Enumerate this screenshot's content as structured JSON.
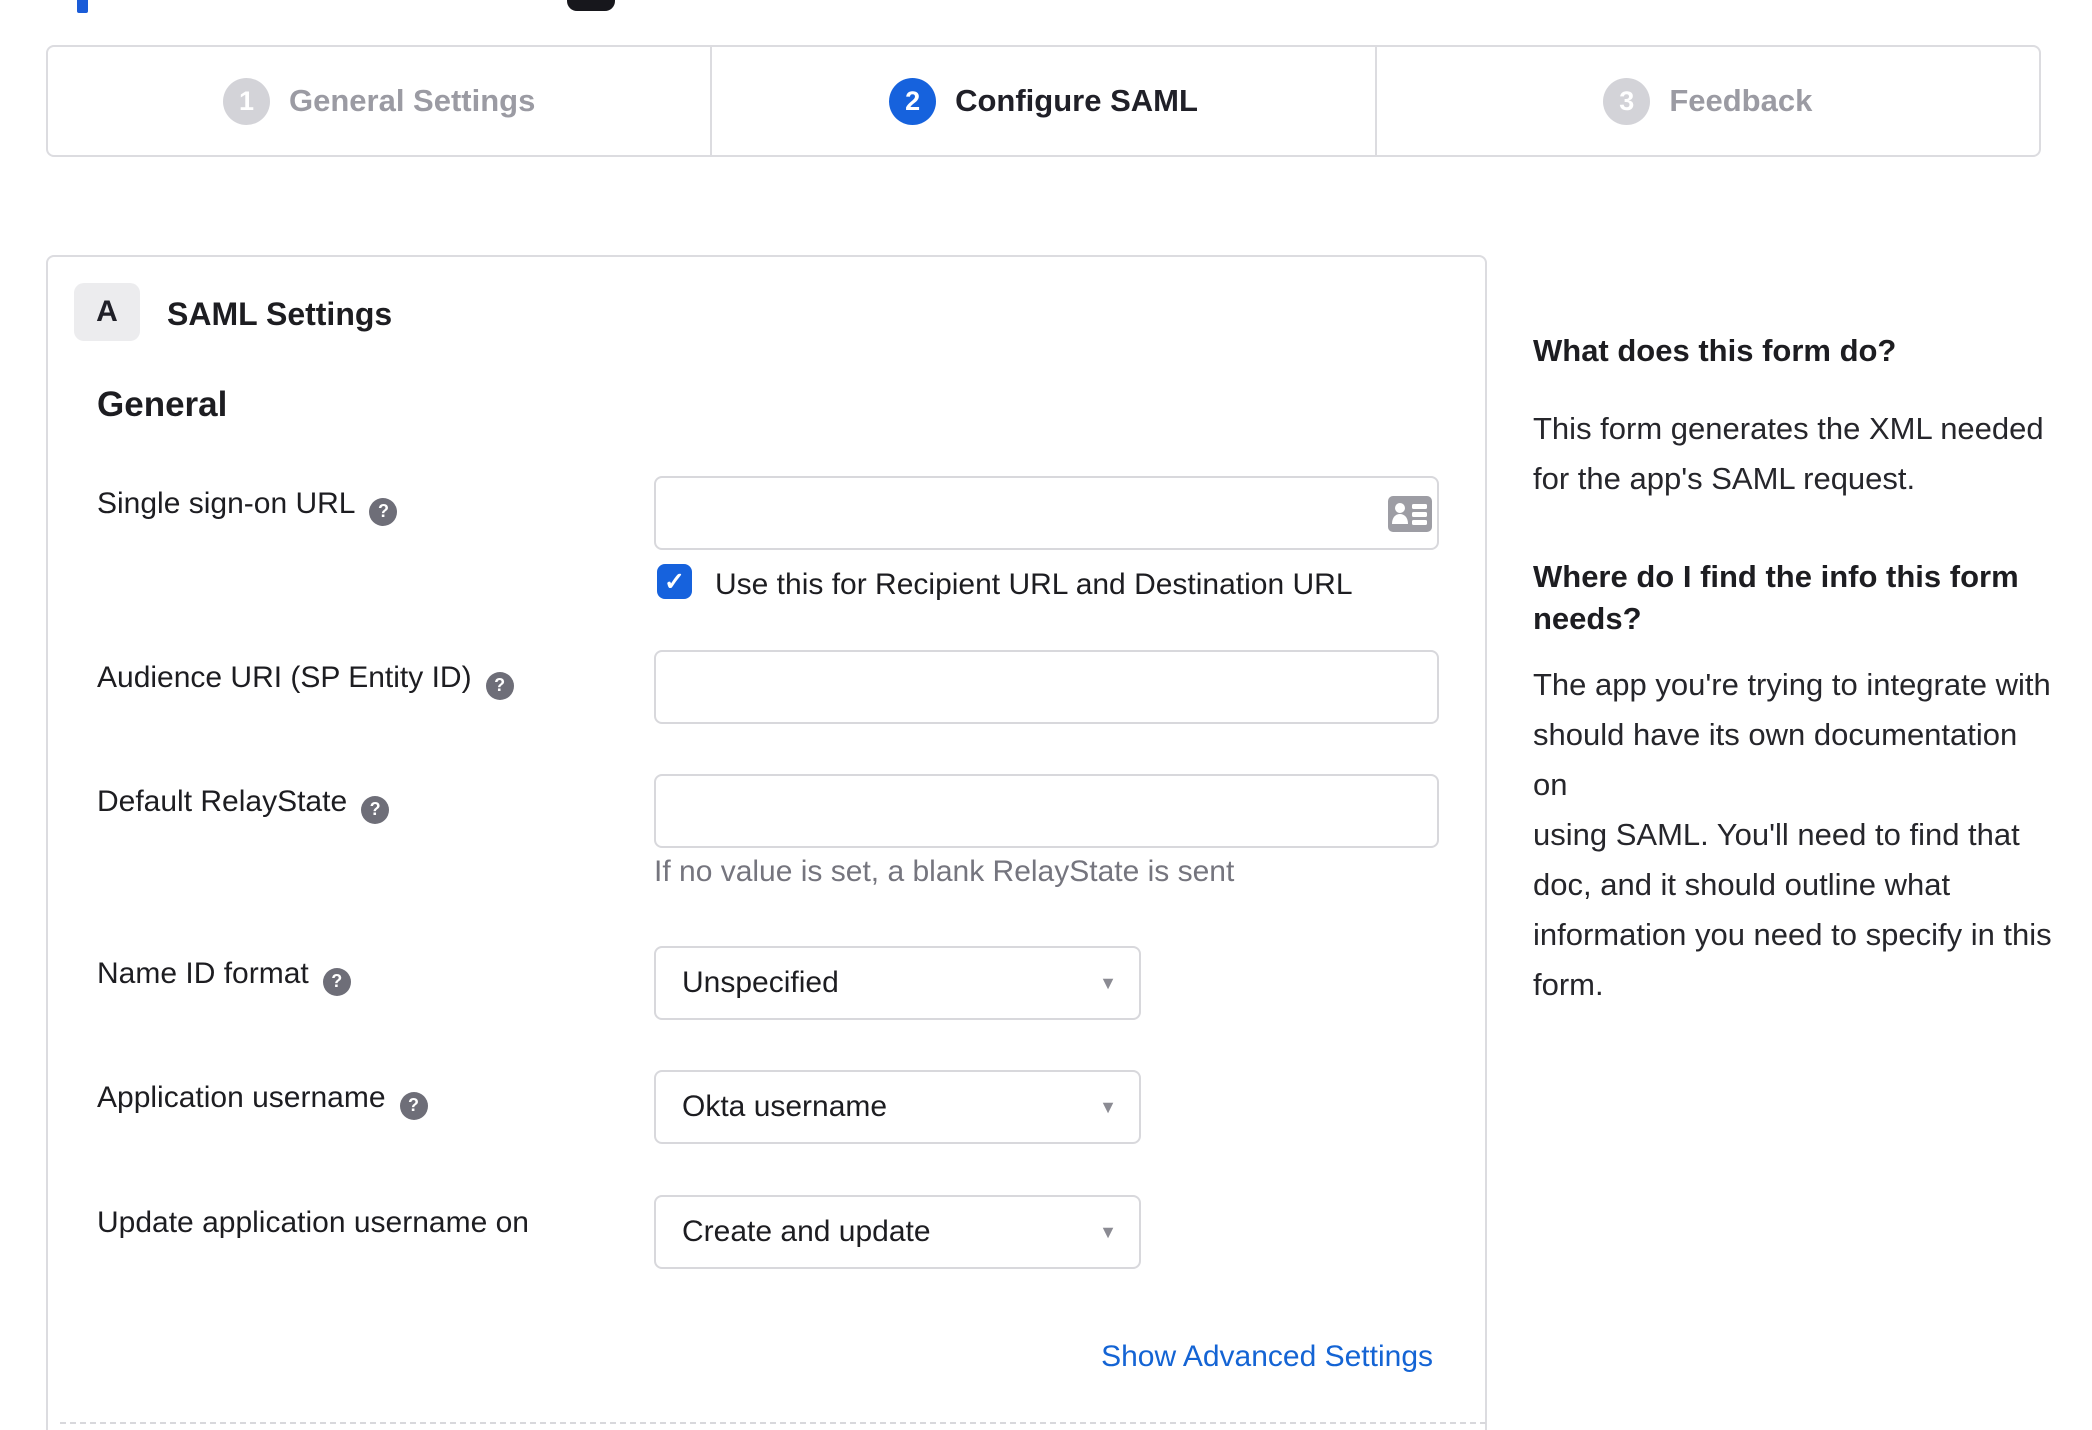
{
  "stepper": {
    "steps": [
      {
        "number": "1",
        "label": "General Settings",
        "state": "inactive"
      },
      {
        "number": "2",
        "label": "Configure SAML",
        "state": "active"
      },
      {
        "number": "3",
        "label": "Feedback",
        "state": "inactive"
      }
    ]
  },
  "panel": {
    "section_badge": "A",
    "section_title": "SAML Settings",
    "group_heading": "General",
    "advanced_link": "Show Advanced Settings"
  },
  "fields": {
    "sso_url": {
      "label": "Single sign-on URL",
      "value": "",
      "checkbox_label": "Use this for Recipient URL and Destination URL",
      "checked": true
    },
    "audience_uri": {
      "label": "Audience URI (SP Entity ID)",
      "value": ""
    },
    "relay_state": {
      "label": "Default RelayState",
      "value": "",
      "hint": "If no value is set, a blank RelayState is sent"
    },
    "name_id_format": {
      "label": "Name ID format",
      "value": "Unspecified"
    },
    "app_username": {
      "label": "Application username",
      "value": "Okta username"
    },
    "update_username": {
      "label": "Update application username on",
      "value": "Create and update"
    }
  },
  "sidebar": {
    "q1": "What does this form do?",
    "a1": "This form generates the XML needed\nfor the app's SAML request.",
    "q2": "Where do I find the info this form\nneeds?",
    "a2": "The app you're trying to integrate with\nshould have its own documentation on\nusing SAML. You'll need to find that\ndoc, and it should outline what\ninformation you need to specify in this\nform."
  },
  "icons": {
    "help_glyph": "?",
    "caret_glyph": "▼",
    "check_glyph": "✓"
  },
  "colors": {
    "accent_blue": "#1662dd",
    "link_blue": "#1464d4",
    "border_gray": "#d8d8dc",
    "inactive_gray": "#9b9ba3",
    "text_dark": "#1d1d21"
  }
}
